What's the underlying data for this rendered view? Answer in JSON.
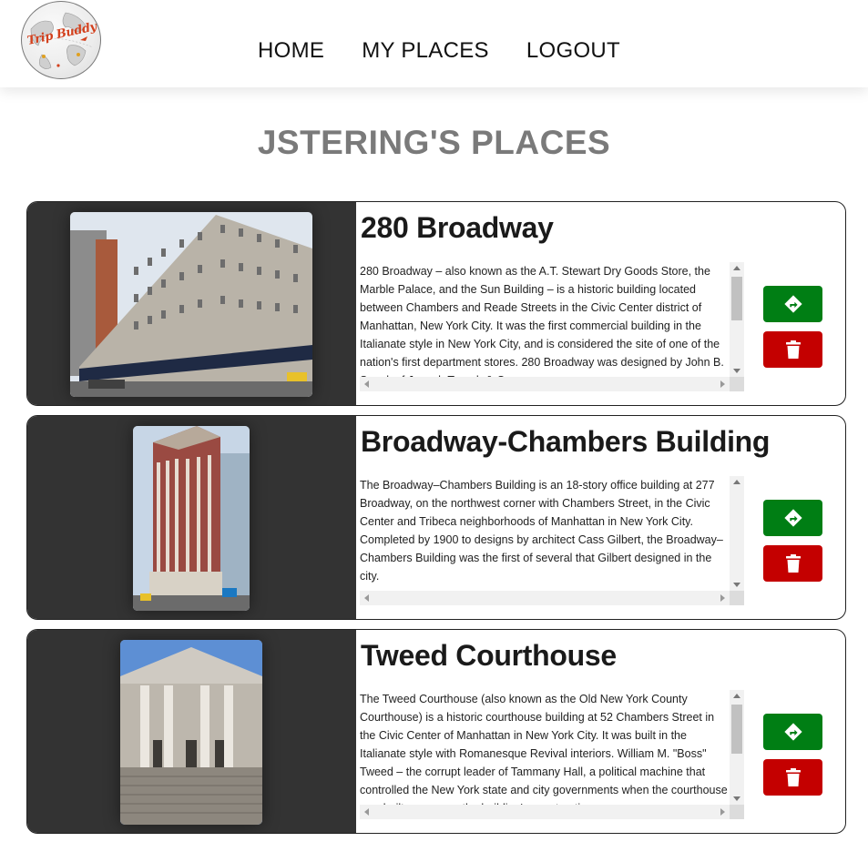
{
  "header": {
    "logo_text": "Trip Buddy",
    "nav": [
      {
        "label": "HOME"
      },
      {
        "label": "MY PLACES"
      },
      {
        "label": "LOGOUT"
      }
    ]
  },
  "page_title": "JSTERING'S PLACES",
  "places": [
    {
      "name": "280 Broadway",
      "description": "280 Broadway – also known as the A.T. Stewart Dry Goods Store, the Marble Palace, and the Sun Building – is a historic building located between Chambers and Reade Streets in the Civic Center district of Manhattan, New York City. It was the first commercial building in the Italianate style in New York City, and is considered the site of one of the nation's first department stores. 280 Broadway was designed by John B. Snook of Joseph Trench & Company.",
      "directions_icon": "directions-icon",
      "delete_icon": "trash-icon"
    },
    {
      "name": "Broadway-Chambers Building",
      "description": "The Broadway–Chambers Building is an 18-story office building at 277 Broadway, on the northwest corner with Chambers Street, in the Civic Center and Tribeca neighborhoods of Manhattan in New York City. Completed by 1900 to designs by architect Cass Gilbert, the Broadway–Chambers Building was the first of several that Gilbert designed in the city.",
      "directions_icon": "directions-icon",
      "delete_icon": "trash-icon"
    },
    {
      "name": "Tweed Courthouse",
      "description": "The Tweed Courthouse (also known as the Old New York County Courthouse) is a historic courthouse building at 52 Chambers Street in the Civic Center of Manhattan in New York City. It was built in the Italianate style with Romanesque Revival interiors. William M. \"Boss\" Tweed – the corrupt leader of Tammany Hall, a political machine that controlled the New York state and city governments when the courthouse was built – oversaw the building's construction.",
      "directions_icon": "directions-icon",
      "delete_icon": "trash-icon"
    }
  ],
  "colors": {
    "card_image_bg": "#333333",
    "directions_button": "#007e14",
    "delete_button": "#c40000",
    "title_gray": "#7a7a7a"
  }
}
